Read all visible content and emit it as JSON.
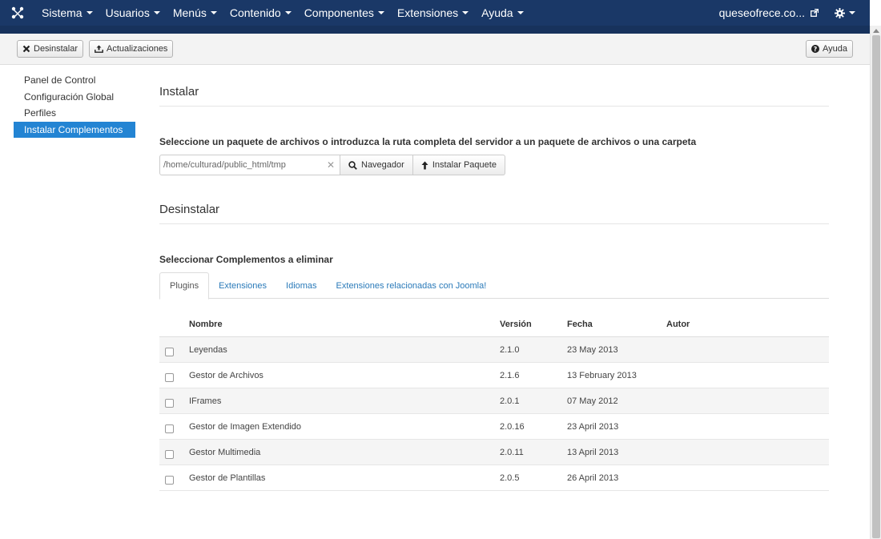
{
  "nav": {
    "brand_icon": "joomla-icon",
    "menu": [
      "Sistema",
      "Usuarios",
      "Menús",
      "Contenido",
      "Componentes",
      "Extensiones",
      "Ayuda"
    ],
    "site_label": "queseofrece.co...",
    "colors": {
      "bar": "#1a3867",
      "active": "#2384d3"
    }
  },
  "toolbar": {
    "uninstall_label": "Desinstalar",
    "updates_label": "Actualizaciones",
    "help_label": "Ayuda"
  },
  "sidebar": {
    "items": [
      {
        "label": "Panel de Control"
      },
      {
        "label": "Configuración Global"
      },
      {
        "label": "Perfiles"
      },
      {
        "label": "Instalar Complementos"
      }
    ]
  },
  "install": {
    "title": "Instalar",
    "instruction": "Seleccione un paquete de archivos o introduzca la ruta completa del servidor a un paquete de archivos o una carpeta",
    "path_value": "/home/culturad/public_html/tmp",
    "browse_label": "Navegador",
    "install_label": "Instalar Paquete"
  },
  "uninstall": {
    "title": "Desinstalar",
    "select_label": "Seleccionar Complementos a eliminar",
    "tabs": [
      "Plugins",
      "Extensiones",
      "Idiomas",
      "Extensiones relacionadas con Joomla!"
    ],
    "columns": {
      "name": "Nombre",
      "version": "Versión",
      "date": "Fecha",
      "author": "Autor"
    },
    "rows": [
      {
        "name": "Leyendas",
        "version": "2.1.0",
        "date": "23 May 2013",
        "author": ""
      },
      {
        "name": "Gestor de Archivos",
        "version": "2.1.6",
        "date": "13 February 2013",
        "author": ""
      },
      {
        "name": "IFrames",
        "version": "2.0.1",
        "date": "07 May 2012",
        "author": ""
      },
      {
        "name": "Gestor de Imagen Extendido",
        "version": "2.0.16",
        "date": "23 April 2013",
        "author": ""
      },
      {
        "name": "Gestor Multimedia",
        "version": "2.0.11",
        "date": "13 April 2013",
        "author": ""
      },
      {
        "name": "Gestor de Plantillas",
        "version": "2.0.5",
        "date": "26 April 2013",
        "author": ""
      }
    ]
  }
}
